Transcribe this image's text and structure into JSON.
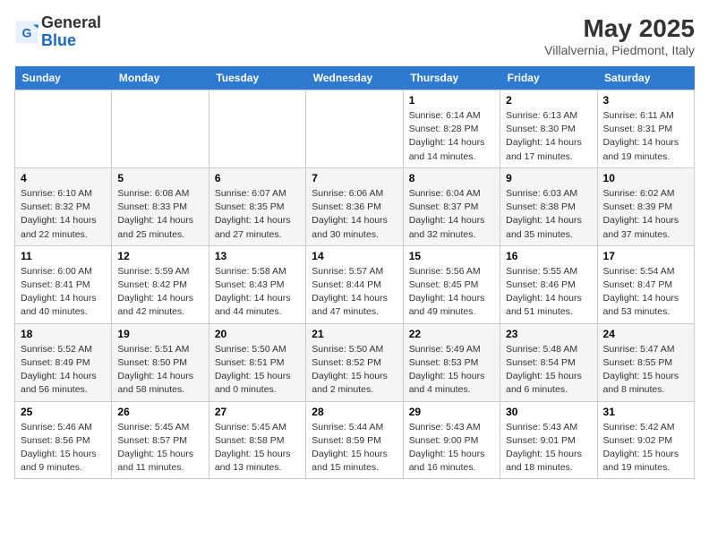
{
  "header": {
    "logo_general": "General",
    "logo_blue": "Blue",
    "month_year": "May 2025",
    "location": "Villalvernia, Piedmont, Italy"
  },
  "days_of_week": [
    "Sunday",
    "Monday",
    "Tuesday",
    "Wednesday",
    "Thursday",
    "Friday",
    "Saturday"
  ],
  "weeks": [
    [
      {
        "day": "",
        "content": ""
      },
      {
        "day": "",
        "content": ""
      },
      {
        "day": "",
        "content": ""
      },
      {
        "day": "",
        "content": ""
      },
      {
        "day": "1",
        "content": "Sunrise: 6:14 AM\nSunset: 8:28 PM\nDaylight: 14 hours\nand 14 minutes."
      },
      {
        "day": "2",
        "content": "Sunrise: 6:13 AM\nSunset: 8:30 PM\nDaylight: 14 hours\nand 17 minutes."
      },
      {
        "day": "3",
        "content": "Sunrise: 6:11 AM\nSunset: 8:31 PM\nDaylight: 14 hours\nand 19 minutes."
      }
    ],
    [
      {
        "day": "4",
        "content": "Sunrise: 6:10 AM\nSunset: 8:32 PM\nDaylight: 14 hours\nand 22 minutes."
      },
      {
        "day": "5",
        "content": "Sunrise: 6:08 AM\nSunset: 8:33 PM\nDaylight: 14 hours\nand 25 minutes."
      },
      {
        "day": "6",
        "content": "Sunrise: 6:07 AM\nSunset: 8:35 PM\nDaylight: 14 hours\nand 27 minutes."
      },
      {
        "day": "7",
        "content": "Sunrise: 6:06 AM\nSunset: 8:36 PM\nDaylight: 14 hours\nand 30 minutes."
      },
      {
        "day": "8",
        "content": "Sunrise: 6:04 AM\nSunset: 8:37 PM\nDaylight: 14 hours\nand 32 minutes."
      },
      {
        "day": "9",
        "content": "Sunrise: 6:03 AM\nSunset: 8:38 PM\nDaylight: 14 hours\nand 35 minutes."
      },
      {
        "day": "10",
        "content": "Sunrise: 6:02 AM\nSunset: 8:39 PM\nDaylight: 14 hours\nand 37 minutes."
      }
    ],
    [
      {
        "day": "11",
        "content": "Sunrise: 6:00 AM\nSunset: 8:41 PM\nDaylight: 14 hours\nand 40 minutes."
      },
      {
        "day": "12",
        "content": "Sunrise: 5:59 AM\nSunset: 8:42 PM\nDaylight: 14 hours\nand 42 minutes."
      },
      {
        "day": "13",
        "content": "Sunrise: 5:58 AM\nSunset: 8:43 PM\nDaylight: 14 hours\nand 44 minutes."
      },
      {
        "day": "14",
        "content": "Sunrise: 5:57 AM\nSunset: 8:44 PM\nDaylight: 14 hours\nand 47 minutes."
      },
      {
        "day": "15",
        "content": "Sunrise: 5:56 AM\nSunset: 8:45 PM\nDaylight: 14 hours\nand 49 minutes."
      },
      {
        "day": "16",
        "content": "Sunrise: 5:55 AM\nSunset: 8:46 PM\nDaylight: 14 hours\nand 51 minutes."
      },
      {
        "day": "17",
        "content": "Sunrise: 5:54 AM\nSunset: 8:47 PM\nDaylight: 14 hours\nand 53 minutes."
      }
    ],
    [
      {
        "day": "18",
        "content": "Sunrise: 5:52 AM\nSunset: 8:49 PM\nDaylight: 14 hours\nand 56 minutes."
      },
      {
        "day": "19",
        "content": "Sunrise: 5:51 AM\nSunset: 8:50 PM\nDaylight: 14 hours\nand 58 minutes."
      },
      {
        "day": "20",
        "content": "Sunrise: 5:50 AM\nSunset: 8:51 PM\nDaylight: 15 hours\nand 0 minutes."
      },
      {
        "day": "21",
        "content": "Sunrise: 5:50 AM\nSunset: 8:52 PM\nDaylight: 15 hours\nand 2 minutes."
      },
      {
        "day": "22",
        "content": "Sunrise: 5:49 AM\nSunset: 8:53 PM\nDaylight: 15 hours\nand 4 minutes."
      },
      {
        "day": "23",
        "content": "Sunrise: 5:48 AM\nSunset: 8:54 PM\nDaylight: 15 hours\nand 6 minutes."
      },
      {
        "day": "24",
        "content": "Sunrise: 5:47 AM\nSunset: 8:55 PM\nDaylight: 15 hours\nand 8 minutes."
      }
    ],
    [
      {
        "day": "25",
        "content": "Sunrise: 5:46 AM\nSunset: 8:56 PM\nDaylight: 15 hours\nand 9 minutes."
      },
      {
        "day": "26",
        "content": "Sunrise: 5:45 AM\nSunset: 8:57 PM\nDaylight: 15 hours\nand 11 minutes."
      },
      {
        "day": "27",
        "content": "Sunrise: 5:45 AM\nSunset: 8:58 PM\nDaylight: 15 hours\nand 13 minutes."
      },
      {
        "day": "28",
        "content": "Sunrise: 5:44 AM\nSunset: 8:59 PM\nDaylight: 15 hours\nand 15 minutes."
      },
      {
        "day": "29",
        "content": "Sunrise: 5:43 AM\nSunset: 9:00 PM\nDaylight: 15 hours\nand 16 minutes."
      },
      {
        "day": "30",
        "content": "Sunrise: 5:43 AM\nSunset: 9:01 PM\nDaylight: 15 hours\nand 18 minutes."
      },
      {
        "day": "31",
        "content": "Sunrise: 5:42 AM\nSunset: 9:02 PM\nDaylight: 15 hours\nand 19 minutes."
      }
    ]
  ]
}
